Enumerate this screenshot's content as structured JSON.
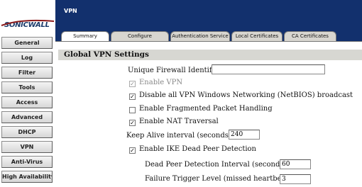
{
  "brand": {
    "name": "SONICWALL"
  },
  "sidebar": {
    "items": [
      {
        "label": "General"
      },
      {
        "label": "Log"
      },
      {
        "label": "Filter"
      },
      {
        "label": "Tools"
      },
      {
        "label": "Access"
      },
      {
        "label": "Advanced"
      },
      {
        "label": "DHCP"
      },
      {
        "label": "VPN"
      },
      {
        "label": "Anti-Virus"
      },
      {
        "label": "High Availability"
      }
    ]
  },
  "header": {
    "title": "VPN",
    "tabs": [
      {
        "label": "Summary",
        "active": true
      },
      {
        "label": "Configure"
      },
      {
        "label": "Authentication Service"
      },
      {
        "label": "Local Certificates"
      },
      {
        "label": "CA Certificates"
      }
    ]
  },
  "main": {
    "section_title": "Global VPN Settings",
    "unique_firewall_identifier": {
      "label": "Unique Firewall Identifier",
      "value": ""
    },
    "enable_vpn": {
      "label": "Enable VPN",
      "checked": true,
      "disabled": true
    },
    "disable_netbios": {
      "label": "Disable all VPN Windows Networking (NetBIOS) broadcast",
      "checked": true
    },
    "enable_fragmented": {
      "label": "Enable Fragmented Packet Handling",
      "checked": false
    },
    "enable_nat_traversal": {
      "label": "Enable NAT Traversal",
      "checked": true
    },
    "keep_alive": {
      "label": "Keep Alive interval (seconds)",
      "value": "240"
    },
    "enable_ike_dpd": {
      "label": "Enable IKE Dead Peer Detection",
      "checked": true
    },
    "dpd_interval": {
      "label": "Dead Peer Detection Interval (seconds)",
      "value": "60"
    },
    "failure_trigger": {
      "label": "Failure Trigger Level (missed heartbeats)",
      "value": "3"
    }
  },
  "colors": {
    "header_bg": "#12306d",
    "section_bar": "#d7d7d2",
    "brand_text": "#1a3a6a"
  }
}
